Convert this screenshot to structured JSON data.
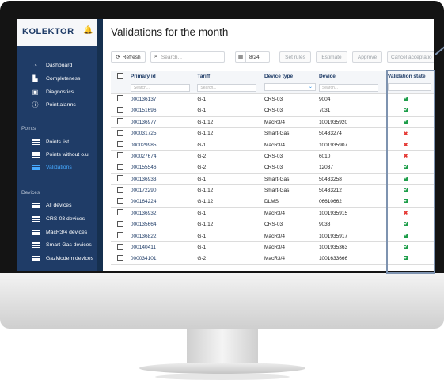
{
  "app": {
    "brand": "KOLEKTOR"
  },
  "sidebar": {
    "items": [
      {
        "label": "Dashboard",
        "icon": "dashboard-icon"
      },
      {
        "label": "Completeness",
        "icon": "bar-chart-icon"
      },
      {
        "label": "Diagnostics",
        "icon": "diagnostics-icon"
      },
      {
        "label": "Point alarms",
        "icon": "alarm-icon"
      }
    ],
    "points_section": "Points",
    "points_items": [
      {
        "label": "Points list"
      },
      {
        "label": "Points without o.u."
      },
      {
        "label": "Validations"
      }
    ],
    "devices_section": "Devices",
    "devices_items": [
      {
        "label": "All devices"
      },
      {
        "label": "CRS-03 devices"
      },
      {
        "label": "MacR3/4 devices"
      },
      {
        "label": "Smart-Gas devices"
      },
      {
        "label": "GazModem devices"
      }
    ]
  },
  "main": {
    "title": "Validations for the month",
    "toolbar": {
      "refresh": "Refresh",
      "search_placeholder": "Search...",
      "date": "8/24",
      "set_rules": "Set rules",
      "estimate": "Estimate",
      "approve": "Approve",
      "cancel": "Cancel acceptatio"
    },
    "table": {
      "headers": [
        "Primary id",
        "Tariff",
        "Device type",
        "Device",
        "Validation state"
      ],
      "filter_placeholder": "Search...",
      "rows": [
        {
          "pid": "000136137",
          "tariff": "G-1",
          "type": "CRS-03",
          "device": "9004",
          "state": "ok"
        },
        {
          "pid": "000151696",
          "tariff": "G-1",
          "type": "CRS-03",
          "device": "7031",
          "state": "ok"
        },
        {
          "pid": "000136977",
          "tariff": "G-1.12",
          "type": "MacR3/4",
          "device": "1001935920",
          "state": "ok"
        },
        {
          "pid": "000031725",
          "tariff": "G-1.12",
          "type": "Smart-Gas",
          "device": "50433274",
          "state": "error"
        },
        {
          "pid": "000029985",
          "tariff": "G-1",
          "type": "MacR3/4",
          "device": "1001935907",
          "state": "error"
        },
        {
          "pid": "000027674",
          "tariff": "G-2",
          "type": "CRS-03",
          "device": "6010",
          "state": "error"
        },
        {
          "pid": "000155546",
          "tariff": "G-2",
          "type": "CRS-03",
          "device": "12037",
          "state": "ok"
        },
        {
          "pid": "000136933",
          "tariff": "G-1",
          "type": "Smart-Gas",
          "device": "50433258",
          "state": "ok"
        },
        {
          "pid": "000172290",
          "tariff": "G-1.12",
          "type": "Smart-Gas",
          "device": "50433212",
          "state": "ok"
        },
        {
          "pid": "000164224",
          "tariff": "G-1.12",
          "type": "DLMS",
          "device": "06610662",
          "state": "ok"
        },
        {
          "pid": "000136932",
          "tariff": "G-1",
          "type": "MacR3/4",
          "device": "1001935915",
          "state": "error"
        },
        {
          "pid": "000135664",
          "tariff": "G-1.12",
          "type": "CRS-03",
          "device": "9038",
          "state": "ok"
        },
        {
          "pid": "000136822",
          "tariff": "G-1",
          "type": "MacR3/4",
          "device": "1001935917",
          "state": "ok"
        },
        {
          "pid": "000140411",
          "tariff": "G-1",
          "type": "MacR3/4",
          "device": "1001935363",
          "state": "ok"
        },
        {
          "pid": "000034101",
          "tariff": "G-2",
          "type": "MacR3/4",
          "device": "1001633666",
          "state": "ok"
        }
      ]
    }
  },
  "colors": {
    "sidebar": "#1f3c67",
    "active": "#46a9ff",
    "ok": "#1e9e4a",
    "error": "#e53935"
  }
}
